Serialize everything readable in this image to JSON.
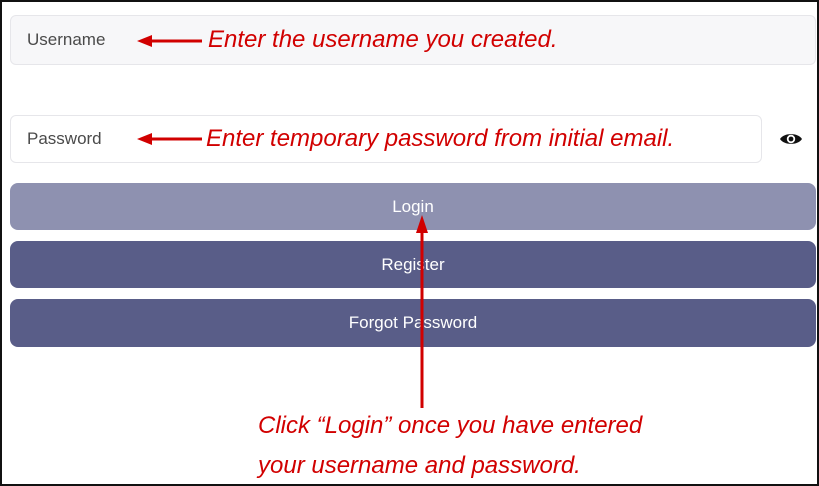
{
  "login_form": {
    "username_placeholder": "Username",
    "password_placeholder": "Password",
    "login_label": "Login",
    "register_label": "Register",
    "forgot_password_label": "Forgot Password",
    "show_password_icon": "eye-icon"
  },
  "annotations": {
    "username_note": "Enter the username you created.",
    "password_note": "Enter temporary password from initial email.",
    "login_note_line1": "Click “Login” once you have entered",
    "login_note_line2": "your username and password."
  },
  "colors": {
    "annotation": "#d10000",
    "login_button": "#8e91b0",
    "secondary_button": "#595d88",
    "field_border": "#e6e6ea"
  }
}
